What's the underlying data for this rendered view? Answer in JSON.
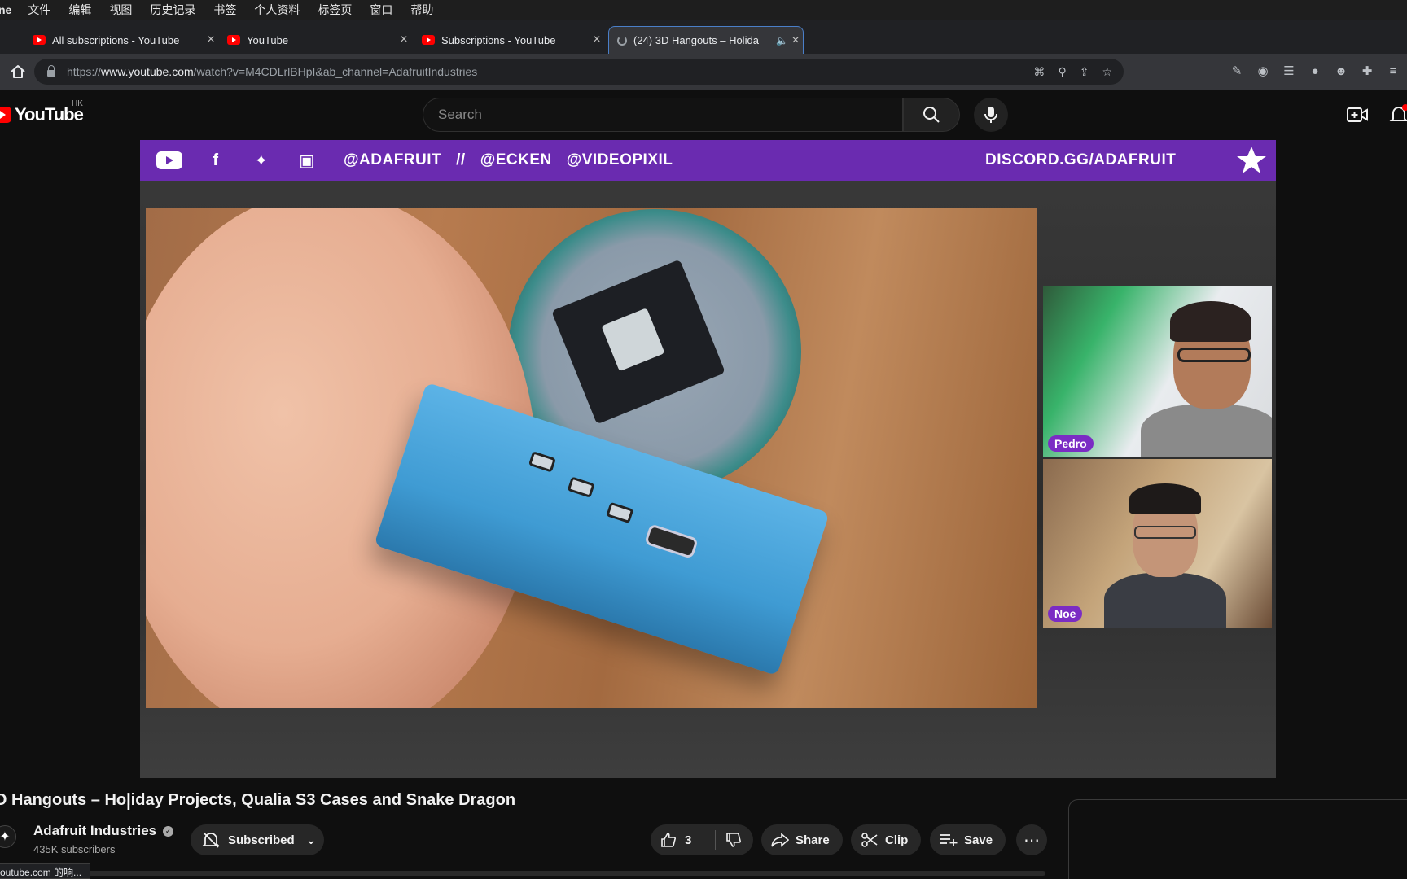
{
  "menubar": {
    "app_partial": "ne",
    "items": [
      "文件",
      "编辑",
      "视图",
      "历史记录",
      "书签",
      "个人资料",
      "标签页",
      "窗口",
      "帮助"
    ]
  },
  "tabs": [
    {
      "title": "All subscriptions - YouTube",
      "close": "×"
    },
    {
      "title": "YouTube",
      "close": "×"
    },
    {
      "title": "Subscriptions - YouTube",
      "close": "×"
    },
    {
      "title": "(24) 3D Hangouts – Holida",
      "close": "×",
      "audio": "🔈"
    }
  ],
  "new_tab": "+",
  "address": {
    "prefix": "https://",
    "host": "www.youtube.com",
    "path": "/watch?v=M4CDLrlBHpI&ab_channel=AdafruitIndustries"
  },
  "youtube": {
    "logo_text": "YouTube",
    "region": "HK",
    "search_placeholder": "Search"
  },
  "video": {
    "banner": {
      "handles": [
        "@ADAFRUIT",
        "//",
        "@ECKEN",
        "@VIDEOPIXIL"
      ],
      "discord": "DISCORD.GG/ADAFRUIT"
    },
    "participants": [
      "Pedro",
      "Noe"
    ],
    "title": "D Hangouts – Holiday Projects, Qualia S3 Cases and Snake Dragon"
  },
  "channel": {
    "name": "Adafruit Industries",
    "subscribers": "435K subscribers",
    "subscribe_label": "Subscribed"
  },
  "actions": {
    "like_count": "3",
    "share": "Share",
    "clip": "Clip",
    "save": "Save",
    "more": "⋯"
  },
  "statusbar": "outube.com 的响...",
  "colors": {
    "youtube_red": "#ff0000",
    "banner_purple": "#6a2bb0",
    "tag_purple": "#7b2cc4"
  }
}
